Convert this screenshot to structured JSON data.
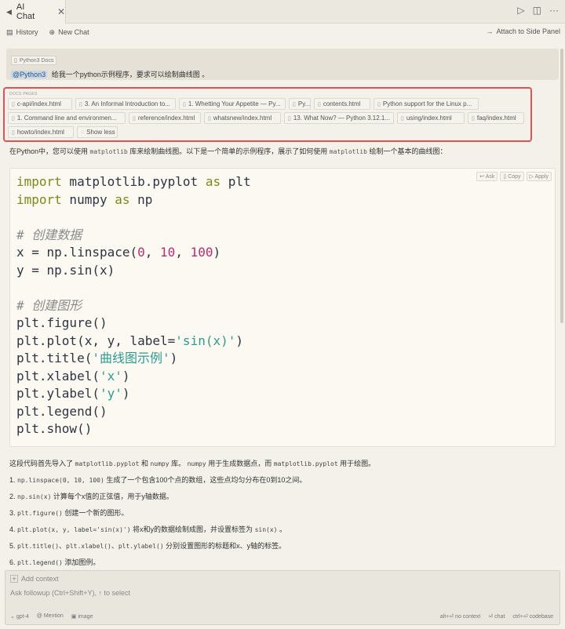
{
  "tab": {
    "title": "AI Chat",
    "close": "✕"
  },
  "toolbar": {
    "history": "History",
    "new_chat": "New Chat",
    "attach": "Attach to Side Panel"
  },
  "query": {
    "context_tag": "Python3 Docs",
    "mention": "@Python3",
    "text": "给我一个python示例程序，要求可以绘制曲线图 。"
  },
  "docs": {
    "label": "DOCS PAGES",
    "chips": [
      "c-api/index.html",
      "3. An Informal Introduction to...",
      "1. Whetting Your Appetite — Py...",
      "Py...",
      "contents.html",
      "Python support for the Linux p...",
      "1. Command line and environmen...",
      "reference/index.html",
      "whatsnew/index.html",
      "13. What Now? — Python 3.12.1...",
      "using/index.html",
      "faq/index.html",
      "howto/index.html"
    ],
    "show_less": "Show less"
  },
  "intro": {
    "p1": "在Python中，您可以使用",
    "c1": "matplotlib",
    "p2": "库来绘制曲线图。以下是一个简单的示例程序，展示了如何使用",
    "c2": "matplotlib",
    "p3": "绘制一个基本的曲线图："
  },
  "code_actions": {
    "ask": "Ask",
    "copy": "Copy",
    "apply": "Apply"
  },
  "code": {
    "l1_kw": "import",
    "l1_mod": " matplotlib.pyplot ",
    "l1_as": "as",
    "l1_alias": " plt",
    "l2_kw": "import",
    "l2_mod": " numpy ",
    "l2_as": "as",
    "l2_alias": " np",
    "c1": "# 创建数据",
    "l3_a": "x = np.",
    "l3_fn": "linspace",
    "l3_b": "(",
    "l3_n1": "0",
    "l3_c": ", ",
    "l3_n2": "10",
    "l3_d": ", ",
    "l3_n3": "100",
    "l3_e": ")",
    "l4_a": "y = np.",
    "l4_fn": "sin",
    "l4_b": "(x)",
    "c2": "# 创建图形",
    "l5": "plt.figure()",
    "l6_a": "plt.plot(x, y, label=",
    "l6_s": "'sin(x)'",
    "l6_b": ")",
    "l7_a": "plt.title(",
    "l7_s": "'曲线图示例'",
    "l7_b": ")",
    "l8_a": "plt.xlabel(",
    "l8_s": "'x'",
    "l8_b": ")",
    "l9_a": "plt.ylabel(",
    "l9_s": "'y'",
    "l9_b": ")",
    "l10": "plt.legend()",
    "l11": "plt.show()"
  },
  "explanation": {
    "p1_a": "这段代码首先导入了",
    "p1_c1": "matplotlib.pyplot",
    "p1_b": "和",
    "p1_c2": "numpy",
    "p1_c": "库。",
    "p1_c3": "numpy",
    "p1_d": "用于生成数据点，而",
    "p1_c4": "matplotlib.pyplot",
    "p1_e": "用于绘图。",
    "i1_n": "1.",
    "i1_c": "np.linspace(0, 10, 100)",
    "i1_t": "生成了一个包含100个点的数组，这些点均匀分布在0到10之间。",
    "i2_n": "2.",
    "i2_c": "np.sin(x)",
    "i2_t": "计算每个x值的正弦值，用于y轴数据。",
    "i3_n": "3.",
    "i3_c": "plt.figure()",
    "i3_t": "创建一个新的图形。",
    "i4_n": "4.",
    "i4_c": "plt.plot(x, y, label='sin(x)')",
    "i4_t": "将x和y的数据绘制成图，并设置标签为",
    "i4_c2": "sin(x)",
    "i4_t2": "。",
    "i5_n": "5.",
    "i5_c1": "plt.title()",
    "i5_s1": "、",
    "i5_c2": "plt.xlabel()",
    "i5_s2": "、",
    "i5_c3": "plt.ylabel()",
    "i5_t": "分别设置图形的标题和x、y轴的标签。",
    "i6_n": "6.",
    "i6_c": "plt.legend()",
    "i6_t": "添加图例。"
  },
  "input": {
    "add_context": "Add context",
    "placeholder": "Ask followup (Ctrl+Shift+Y), ↑ to select",
    "model": "gpt-4",
    "mention": "@ Mention",
    "image": "image",
    "no_context": "alt+⏎ no context",
    "chat": "⏎ chat",
    "codebase": "ctrl+⏎ codebase"
  }
}
